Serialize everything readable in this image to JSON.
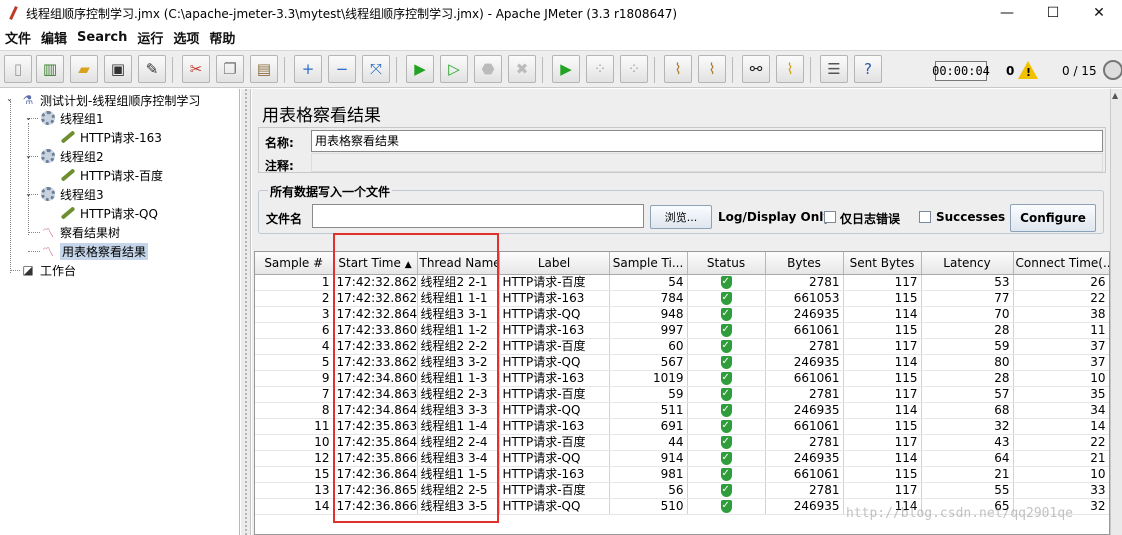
{
  "window": {
    "title": "线程组顺序控制学习.jmx (C:\\apache-jmeter-3.3\\mytest\\线程组顺序控制学习.jmx) - Apache JMeter (3.3 r1808647)",
    "minimize": "—",
    "maximize": "☐",
    "close": "✕"
  },
  "menu": [
    "文件",
    "编辑",
    "Search",
    "运行",
    "选项",
    "帮助"
  ],
  "toolbar": {
    "timer": "00:00:04",
    "error_count": "0",
    "thread_count": "0 / 15",
    "browse_label": "浏览..."
  },
  "tree": {
    "root": "测试计划-线程组顺序控制学习",
    "group1": "线程组1",
    "sampler1": "HTTP请求-163",
    "group2": "线程组2",
    "sampler2": "HTTP请求-百度",
    "group3": "线程组3",
    "sampler3": "HTTP请求-QQ",
    "listener1": "察看结果树",
    "listener2": "用表格察看结果",
    "workbench": "工作台"
  },
  "panel": {
    "title": "用表格察看结果",
    "name_label": "名称:",
    "name_value": "用表格察看结果",
    "comment_label": "注释:",
    "file_section_title": "所有数据写入一个文件",
    "filename_label": "文件名",
    "browse": "浏览...",
    "log_display": "Log/Display Only:",
    "errors_only": "仅日志错误",
    "successes": "Successes",
    "configure": "Configure"
  },
  "table": {
    "columns": [
      "Sample #",
      "Start Time",
      "Thread Name",
      "Label",
      "Sample Ti...",
      "Status",
      "Bytes",
      "Sent Bytes",
      "Latency",
      "Connect Time(..."
    ],
    "sort_indicator": "▲",
    "rows": [
      [
        "1",
        "17:42:32.862",
        "线程组2 2-1",
        "HTTP请求-百度",
        "54",
        "2781",
        "117",
        "53",
        "26"
      ],
      [
        "2",
        "17:42:32.862",
        "线程组1 1-1",
        "HTTP请求-163",
        "784",
        "661053",
        "115",
        "77",
        "22"
      ],
      [
        "3",
        "17:42:32.864",
        "线程组3 3-1",
        "HTTP请求-QQ",
        "948",
        "246935",
        "114",
        "70",
        "38"
      ],
      [
        "6",
        "17:42:33.860",
        "线程组1 1-2",
        "HTTP请求-163",
        "997",
        "661061",
        "115",
        "28",
        "11"
      ],
      [
        "4",
        "17:42:33.862",
        "线程组2 2-2",
        "HTTP请求-百度",
        "60",
        "2781",
        "117",
        "59",
        "37"
      ],
      [
        "5",
        "17:42:33.862",
        "线程组3 3-2",
        "HTTP请求-QQ",
        "567",
        "246935",
        "114",
        "80",
        "37"
      ],
      [
        "9",
        "17:42:34.860",
        "线程组1 1-3",
        "HTTP请求-163",
        "1019",
        "661061",
        "115",
        "28",
        "10"
      ],
      [
        "7",
        "17:42:34.863",
        "线程组2 2-3",
        "HTTP请求-百度",
        "59",
        "2781",
        "117",
        "57",
        "35"
      ],
      [
        "8",
        "17:42:34.864",
        "线程组3 3-3",
        "HTTP请求-QQ",
        "511",
        "246935",
        "114",
        "68",
        "34"
      ],
      [
        "11",
        "17:42:35.863",
        "线程组1 1-4",
        "HTTP请求-163",
        "691",
        "661061",
        "115",
        "32",
        "14"
      ],
      [
        "10",
        "17:42:35.864",
        "线程组2 2-4",
        "HTTP请求-百度",
        "44",
        "2781",
        "117",
        "43",
        "22"
      ],
      [
        "12",
        "17:42:35.866",
        "线程组3 3-4",
        "HTTP请求-QQ",
        "914",
        "246935",
        "114",
        "64",
        "21"
      ],
      [
        "15",
        "17:42:36.864",
        "线程组1 1-5",
        "HTTP请求-163",
        "981",
        "661061",
        "115",
        "21",
        "10"
      ],
      [
        "13",
        "17:42:36.865",
        "线程组2 2-5",
        "HTTP请求-百度",
        "56",
        "2781",
        "117",
        "55",
        "33"
      ],
      [
        "14",
        "17:42:36.866",
        "线程组3 3-5",
        "HTTP请求-QQ",
        "510",
        "246935",
        "114",
        "65",
        "32"
      ]
    ]
  },
  "watermark": "http://blog.csdn.net/qq2901qe",
  "colors": {
    "highlight_box": "#e0312f",
    "status_ok": "#2f9d3b",
    "selection": "#c5d6ea"
  }
}
